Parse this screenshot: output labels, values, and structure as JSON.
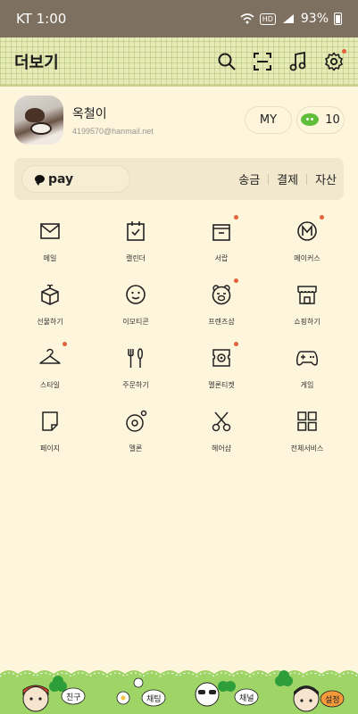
{
  "status": {
    "carrier_time": "KT 1:00",
    "hd": "HD",
    "battery": "93%"
  },
  "header": {
    "title": "더보기"
  },
  "profile": {
    "name": "옥철이",
    "email": "4199570@hanmail.net",
    "my_label": "MY",
    "coin_count": "10"
  },
  "pay": {
    "label": "pay",
    "links": [
      "송금",
      "결제",
      "자산"
    ]
  },
  "grid": [
    {
      "label": "메일",
      "icon": "mail-icon",
      "dot": false
    },
    {
      "label": "캘린더",
      "icon": "calendar-icon",
      "dot": false
    },
    {
      "label": "서랍",
      "icon": "drawer-icon",
      "dot": true
    },
    {
      "label": "메이커스",
      "icon": "makers-icon",
      "dot": true
    },
    {
      "label": "선물하기",
      "icon": "gift-icon",
      "dot": false
    },
    {
      "label": "이모티콘",
      "icon": "emoticon-icon",
      "dot": false
    },
    {
      "label": "프렌즈샵",
      "icon": "friends-shop-icon",
      "dot": true
    },
    {
      "label": "쇼핑하기",
      "icon": "shopping-icon",
      "dot": false
    },
    {
      "label": "스타일",
      "icon": "hanger-icon",
      "dot": true
    },
    {
      "label": "주문하기",
      "icon": "fork-knife-icon",
      "dot": false
    },
    {
      "label": "멜론티켓",
      "icon": "ticket-icon",
      "dot": true
    },
    {
      "label": "게임",
      "icon": "gamepad-icon",
      "dot": false
    },
    {
      "label": "페이지",
      "icon": "page-icon",
      "dot": false
    },
    {
      "label": "멜론",
      "icon": "melon-icon",
      "dot": false
    },
    {
      "label": "헤어샵",
      "icon": "scissors-icon",
      "dot": false
    },
    {
      "label": "전체서비스",
      "icon": "all-services-icon",
      "dot": false
    }
  ],
  "footer": {
    "tabs": [
      "친구",
      "채팅",
      "채널",
      "설정"
    ]
  },
  "colors": {
    "accent_dot": "#e2623a",
    "header_bg": "#e6eab6",
    "page_bg": "#fdf5dc",
    "status_bg": "#7e7060"
  }
}
